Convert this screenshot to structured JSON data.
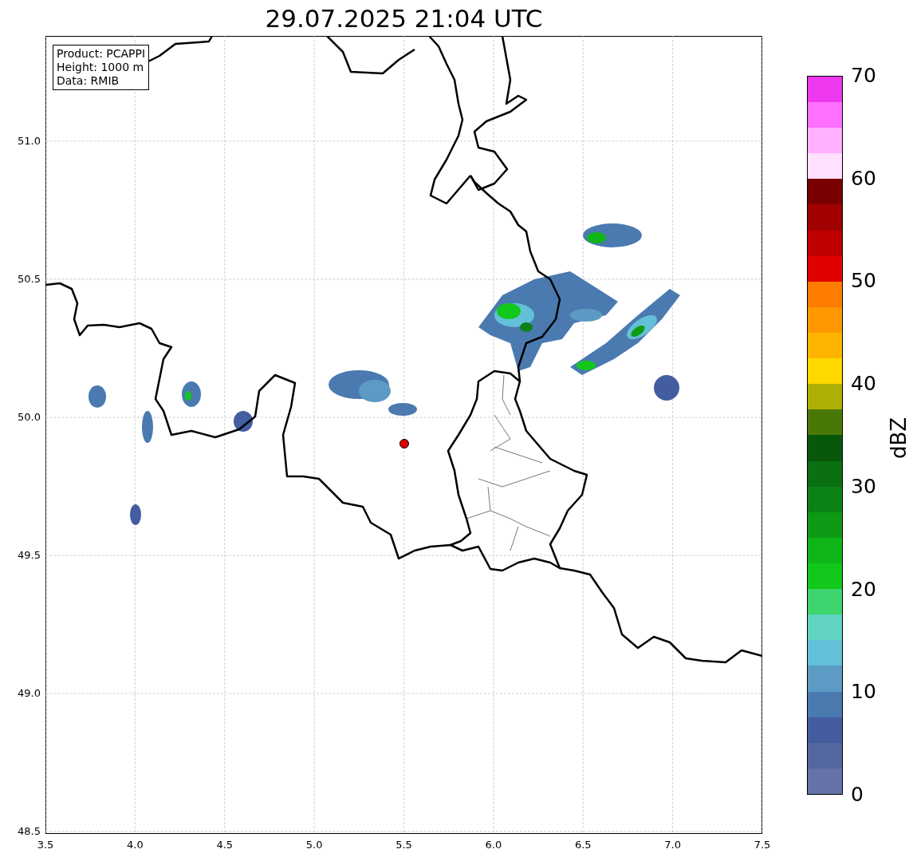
{
  "title": "29.07.2025 21:04 UTC",
  "info_box": {
    "lines": [
      "Product: PCAPPI",
      "Height: 1000 m",
      "Data: RMIB"
    ]
  },
  "x_axis": {
    "ticks": [
      "3.5",
      "4.0",
      "4.5",
      "5.0",
      "5.5",
      "6.0",
      "6.5",
      "7.0",
      "7.5"
    ]
  },
  "y_axis": {
    "ticks": [
      "51.0",
      "50.5",
      "50.0",
      "49.5",
      "49.0",
      "48.5"
    ]
  },
  "colorbar": {
    "label": "dBZ",
    "ticks": [
      "70",
      "60",
      "50",
      "40",
      "30",
      "20",
      "10",
      "0"
    ],
    "segments": [
      {
        "color": "#6673a8"
      },
      {
        "color": "#5467a0"
      },
      {
        "color": "#435da0"
      },
      {
        "color": "#4a7ab0"
      },
      {
        "color": "#5b9bc4"
      },
      {
        "color": "#64c0d8"
      },
      {
        "color": "#60d4c0"
      },
      {
        "color": "#3ed46e"
      },
      {
        "color": "#12c81a"
      },
      {
        "color": "#10b618"
      },
      {
        "color": "#0e9a14"
      },
      {
        "color": "#0c8214"
      },
      {
        "color": "#0a7012"
      },
      {
        "color": "#08580c"
      },
      {
        "color": "#4a7808"
      },
      {
        "color": "#aeb004"
      },
      {
        "color": "#ffd800"
      },
      {
        "color": "#ffb400"
      },
      {
        "color": "#ff9800"
      },
      {
        "color": "#ff7c00"
      },
      {
        "color": "#e00000"
      },
      {
        "color": "#c00000"
      },
      {
        "color": "#a00000"
      },
      {
        "color": "#780000"
      },
      {
        "color": "#ffe0ff"
      },
      {
        "color": "#ffb0ff"
      },
      {
        "color": "#ff70ff"
      },
      {
        "color": "#ee38ee"
      }
    ]
  }
}
